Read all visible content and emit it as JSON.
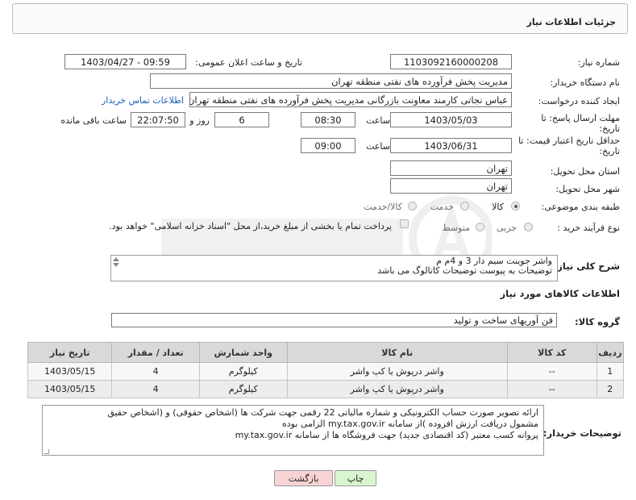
{
  "header": {
    "title": "جزئیات اطلاعات نیاز"
  },
  "form": {
    "need_number": {
      "label": "شماره نیاز:",
      "value": "1103092160000208"
    },
    "announce_datetime": {
      "label": "تاریخ و ساعت اعلان عمومی:",
      "value": "1403/04/27 - 09:59"
    },
    "buyer_org": {
      "label": "نام دستگاه خریدار:",
      "value": "مدیریت پخش فرآورده های نفتی منطقه تهران"
    },
    "requester": {
      "label": "ایجاد کننده درخواست:",
      "value": "عباس نجاتی کارمند معاونت بازرگانی مدیریت پخش فرآورده های نفتی منطقه تهران",
      "contact_link": "اطلاعات تماس خریدار"
    },
    "deadline": {
      "label": "مهلت ارسال پاسخ: تا",
      "label2": "تاریخ:",
      "date": "1403/05/03",
      "time_label": "ساعت",
      "time": "08:30",
      "days": "6",
      "days_label": "روز و",
      "remaining": "22:07:50",
      "remaining_label": "ساعت باقی مانده"
    },
    "validity": {
      "label": "حداقل تاریخ اعتبار قیمت: تا",
      "label2": "تاریخ:",
      "date": "1403/06/31",
      "time_label": "ساعت",
      "time": "09:00"
    },
    "province": {
      "label": "استان محل تحویل:",
      "value": "تهران"
    },
    "city": {
      "label": "شهر محل تحویل:",
      "value": "تهران"
    },
    "category": {
      "label": "طبقه بندی موضوعی:",
      "options": [
        "کالا",
        "خدمت",
        "کالا/خدمت"
      ],
      "selected": "کالا"
    },
    "process": {
      "label": "نوع فرآیند خرید :",
      "options": [
        "جزیی",
        "متوسط"
      ],
      "payment_note": "پرداخت تمام یا بخشی از مبلغ خرید،از محل \"اسناد خزانه اسلامی\" خواهد بود."
    }
  },
  "description": {
    "label": "شرح کلی نیاز:",
    "line1": "واشر جوینت سیم دار 3 و 4م م",
    "line2": "توضیحات به پیوست توضیحات کاتالوگ می باشد"
  },
  "goods": {
    "section_title": "اطلاعات کالاهای مورد نیاز",
    "group_label": "گروه کالا:",
    "group_value": "فن آوریهای ساخت و تولید",
    "columns": [
      "ردیف",
      "کد کالا",
      "نام کالا",
      "واحد شمارش",
      "تعداد / مقدار",
      "تاریخ نیاز"
    ],
    "rows": [
      {
        "idx": "1",
        "code": "--",
        "name": "واشر درپوش یا کپ واشر",
        "unit": "کیلوگرم",
        "qty": "4",
        "date": "1403/05/15"
      },
      {
        "idx": "2",
        "code": "--",
        "name": "واشر درپوش یا کپ واشر",
        "unit": "کیلوگرم",
        "qty": "4",
        "date": "1403/05/15"
      }
    ]
  },
  "buyer_notes": {
    "label": "توضیحات خریدار:",
    "line1": "ارائه  تصویر صورت حساب الکترونیکی و شماره مالیاتی 22 رقمی  جهت شرکت ها (اشخاص حقوقی) و (اشخاص حقیق",
    "line2": "مشمول دریافت ارزش افزوده )از سامانه my.tax.gov.ir  الزامی بوده",
    "line3": "پروانه کسب معتبر (کد اقتصادی جدید) جهت فروشگاه ها از سامانه my.tax.gov.ir"
  },
  "buttons": {
    "print": "چاپ",
    "back": "بازگشت"
  },
  "colors": {
    "print_bg": "#d8f5d0",
    "back_bg": "#f7d3d3",
    "link": "#1a5fb4"
  }
}
